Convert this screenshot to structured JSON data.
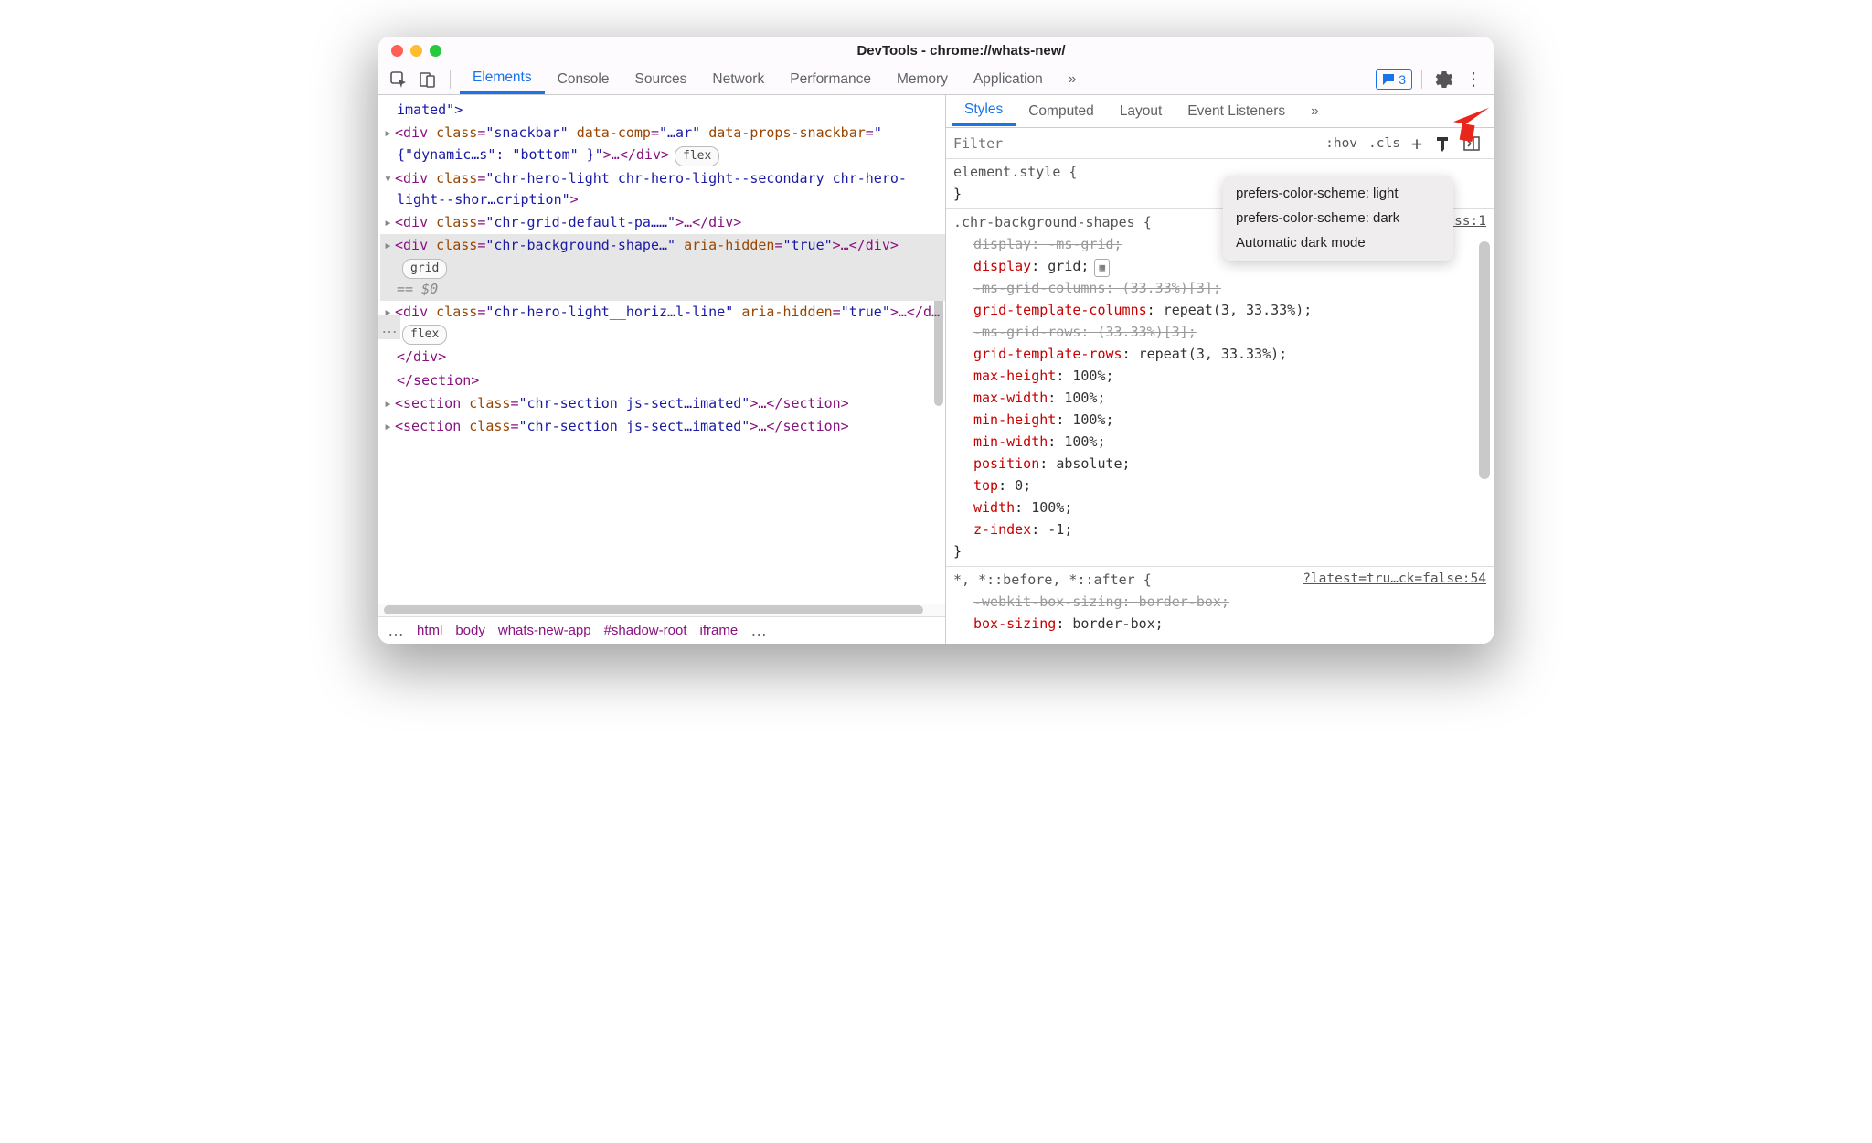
{
  "window": {
    "title": "DevTools - chrome://whats-new/"
  },
  "main_tabs": {
    "items": [
      "Elements",
      "Console",
      "Sources",
      "Network",
      "Performance",
      "Memory",
      "Application"
    ],
    "active": "Elements",
    "more_glyph": "»",
    "issue_count": "3"
  },
  "dom": {
    "l1": {
      "text": "imated\">"
    },
    "l2": {
      "pre": "<div ",
      "cls_n": "class",
      "cls_v": "\"snackbar\"",
      "dc_n": "data-comp",
      "dc_v": "\"…ar\"",
      "dp_n": "data-props-snackbar",
      "dp_v": "\"{\"dynamic…s\": \"bottom\" }\"",
      "post": ">…</div>",
      "badge": "flex"
    },
    "l3": {
      "pre": "<div ",
      "cls_n": "class",
      "cls_v": "\"chr-hero-light chr-hero-light--secondary chr-hero-light--shor…cription\"",
      "post": ">"
    },
    "l4": {
      "pre": "<div ",
      "cls_n": "class",
      "cls_v": "\"chr-grid-default-pa……\"",
      "post": ">…</div>"
    },
    "l5": {
      "pre": "<div ",
      "cls_n": "class",
      "cls_v": "\"chr-background-shape…\"",
      "ah_n": "aria-hidden",
      "ah_v": "\"true\"",
      "post": ">…</div>",
      "badge": "grid",
      "suffix": "== $0"
    },
    "l6": {
      "pre": "<div ",
      "cls_n": "class",
      "cls_v": "\"chr-hero-light__horiz…l-line\"",
      "ah_n": "aria-hidden",
      "ah_v": "\"true\"",
      "post": ">…</d…",
      "badge": "flex"
    },
    "l7": {
      "text": "</div>"
    },
    "l8": {
      "text": "</section>"
    },
    "l9": {
      "pre": "<section ",
      "cls_n": "class",
      "cls_v": "\"chr-section js-sect…imated\"",
      "post": ">…</section>"
    },
    "l10": {
      "pre": "<section ",
      "cls_n": "class",
      "cls_v": "\"chr-section js-sect…imated\"",
      "post": ">…</section>"
    }
  },
  "breadcrumb": [
    "html",
    "body",
    "whats-new-app",
    "#shadow-root",
    "iframe"
  ],
  "styles_tabs": {
    "items": [
      "Styles",
      "Computed",
      "Layout",
      "Event Listeners"
    ],
    "active": "Styles",
    "more_glyph": "»"
  },
  "filter": {
    "placeholder": "Filter",
    "hov": ":hov",
    "cls": ".cls"
  },
  "popover": {
    "items": [
      "prefers-color-scheme: light",
      "prefers-color-scheme: dark",
      "Automatic dark mode"
    ]
  },
  "rule0": {
    "sel": "element.style {",
    "close": "}"
  },
  "rule1": {
    "sel": ".chr-background-shapes {",
    "src": "….css:1",
    "display_strike": "display: -ms-grid;",
    "display": "display",
    "display_v": "grid;",
    "msgc_strike": "-ms-grid-columns: (33.33%)[3];",
    "gtc": "grid-template-columns",
    "gtc_v": "repeat(3, 33.33%);",
    "msgr_strike": "-ms-grid-rows: (33.33%)[3];",
    "gtr": "grid-template-rows",
    "gtr_v": "repeat(3, 33.33%);",
    "maxh": "max-height",
    "maxh_v": "100%;",
    "maxw": "max-width",
    "maxw_v": "100%;",
    "minh": "min-height",
    "minh_v": "100%;",
    "minw": "min-width",
    "minw_v": "100%;",
    "pos": "position",
    "pos_v": "absolute;",
    "top": "top",
    "top_v": "0;",
    "wid": "width",
    "wid_v": "100%;",
    "zi": "z-index",
    "zi_v": "-1;",
    "close": "}"
  },
  "rule2": {
    "sel": "*, *::before, *::after {",
    "src": "?latest=tru…ck=false:54",
    "wbs_strike": "-webkit-box-sizing: border-box;",
    "bs": "box-sizing",
    "bs_v": "border-box;"
  }
}
